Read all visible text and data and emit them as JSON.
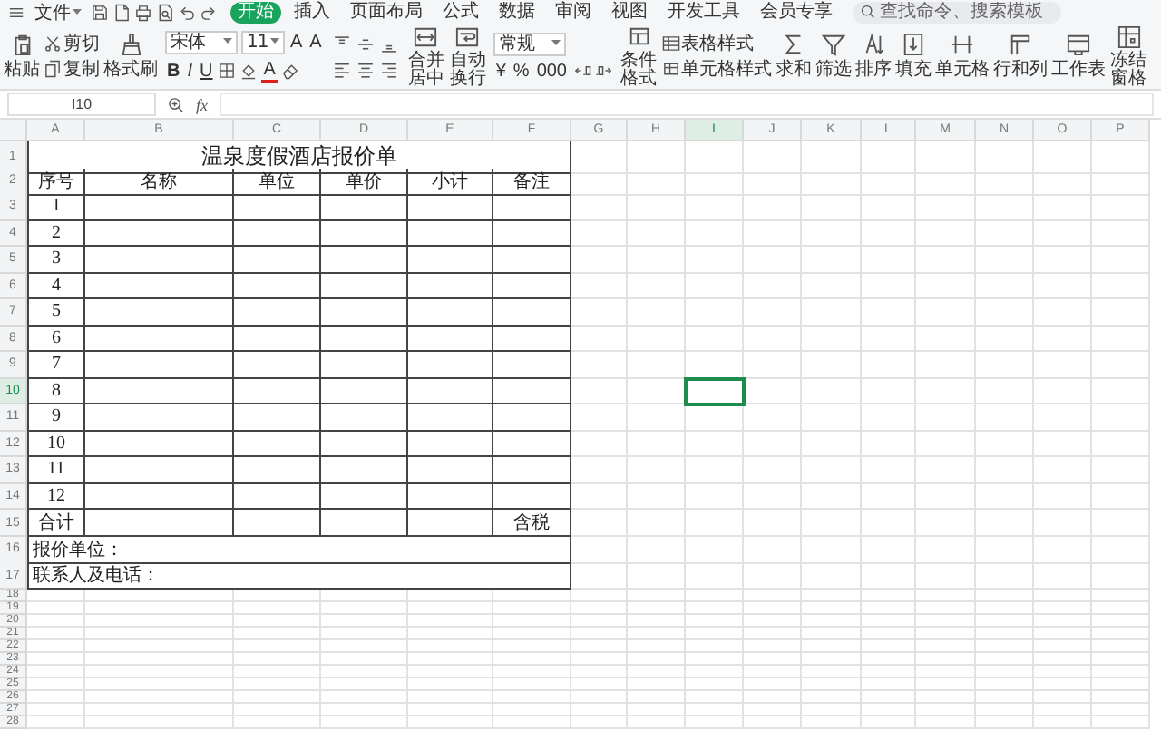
{
  "menu": {
    "file": "文件",
    "tabs": [
      {
        "label": "开始",
        "selected": true
      },
      {
        "label": "插入",
        "selected": false
      },
      {
        "label": "页面布局",
        "selected": false
      },
      {
        "label": "公式",
        "selected": false
      },
      {
        "label": "数据",
        "selected": false
      },
      {
        "label": "审阅",
        "selected": false
      },
      {
        "label": "视图",
        "selected": false
      },
      {
        "label": "开发工具",
        "selected": false
      },
      {
        "label": "会员专享",
        "selected": false
      }
    ],
    "search": {
      "placeholder": "查找命令、搜索模板"
    }
  },
  "ribbon": {
    "items": [
      {
        "kind": "big",
        "label": "粘贴"
      },
      {
        "kind": "stack",
        "labels": [
          "剪切",
          "复制"
        ]
      },
      {
        "kind": "big",
        "label": "格式刷"
      },
      {
        "kind": "font",
        "font": "宋体",
        "size": "11",
        "grow": "A",
        "shrink": "A",
        "styles": [
          "B",
          "I",
          "U"
        ],
        "color_letter": "A"
      },
      {
        "kind": "align"
      },
      {
        "kind": "big",
        "label": "合并居中"
      },
      {
        "kind": "big",
        "label": "自动换行"
      },
      {
        "kind": "number",
        "format": "常规",
        "symbols": [
          "¥",
          "%",
          "000"
        ]
      },
      {
        "kind": "big",
        "label": "条件格式"
      },
      {
        "kind": "stack",
        "labels": [
          "表格样式",
          "单元格样式"
        ]
      },
      {
        "kind": "big",
        "label": "求和"
      },
      {
        "kind": "big",
        "label": "筛选"
      },
      {
        "kind": "big",
        "label": "排序"
      },
      {
        "kind": "big",
        "label": "填充"
      },
      {
        "kind": "big",
        "label": "单元格"
      },
      {
        "kind": "big",
        "label": "行和列"
      },
      {
        "kind": "big",
        "label": "工作表"
      },
      {
        "kind": "big",
        "label": "冻结窗格"
      }
    ]
  },
  "formula_bar": {
    "name_box": "I10",
    "function_label": "fx"
  },
  "sheet": {
    "columns": [
      {
        "label": "A",
        "selected": false
      },
      {
        "label": "B",
        "selected": false
      },
      {
        "label": "C",
        "selected": false
      },
      {
        "label": "D",
        "selected": false
      },
      {
        "label": "E",
        "selected": false
      },
      {
        "label": "F",
        "selected": false
      },
      {
        "label": "G",
        "selected": false
      },
      {
        "label": "H",
        "selected": false
      },
      {
        "label": "I",
        "selected": true
      },
      {
        "label": "J",
        "selected": false
      },
      {
        "label": "K",
        "selected": false
      },
      {
        "label": "L",
        "selected": false
      },
      {
        "label": "M",
        "selected": false
      },
      {
        "label": "N",
        "selected": false
      },
      {
        "label": "O",
        "selected": false
      },
      {
        "label": "P",
        "selected": false
      }
    ],
    "rows": [
      {
        "header": "1",
        "selected": false,
        "kind": "title",
        "text": "温泉度假酒店报价单"
      },
      {
        "header": "2",
        "selected": false,
        "kind": "header",
        "cells": [
          "序号",
          "名称",
          "单位",
          "单价",
          "小计",
          "备注"
        ]
      },
      {
        "header": "3",
        "selected": false,
        "kind": "item",
        "number": "1"
      },
      {
        "header": "4",
        "selected": false,
        "kind": "item",
        "number": "2"
      },
      {
        "header": "5",
        "selected": false,
        "kind": "item",
        "number": "3"
      },
      {
        "header": "6",
        "selected": false,
        "kind": "item",
        "number": "4"
      },
      {
        "header": "7",
        "selected": false,
        "kind": "item",
        "number": "5"
      },
      {
        "header": "8",
        "selected": false,
        "kind": "item",
        "number": "6"
      },
      {
        "header": "9",
        "selected": false,
        "kind": "item",
        "number": "7"
      },
      {
        "header": "10",
        "selected": true,
        "kind": "item",
        "number": "8"
      },
      {
        "header": "11",
        "selected": false,
        "kind": "item",
        "number": "9"
      },
      {
        "header": "12",
        "selected": false,
        "kind": "item",
        "number": "10"
      },
      {
        "header": "13",
        "selected": false,
        "kind": "item",
        "number": "11"
      },
      {
        "header": "14",
        "selected": false,
        "kind": "item",
        "number": "12"
      },
      {
        "header": "15",
        "selected": false,
        "kind": "total",
        "label": "合计",
        "note": "含税"
      },
      {
        "header": "16",
        "selected": false,
        "kind": "text",
        "text": "报价单位："
      },
      {
        "header": "17",
        "selected": false,
        "kind": "text",
        "text": "联系人及电话："
      },
      {
        "header": "18",
        "selected": false,
        "kind": "blank"
      },
      {
        "header": "19",
        "selected": false,
        "kind": "blank"
      },
      {
        "header": "20",
        "selected": false,
        "kind": "blank"
      },
      {
        "header": "21",
        "selected": false,
        "kind": "blank"
      },
      {
        "header": "22",
        "selected": false,
        "kind": "blank"
      },
      {
        "header": "23",
        "selected": false,
        "kind": "blank"
      },
      {
        "header": "24",
        "selected": false,
        "kind": "blank"
      },
      {
        "header": "25",
        "selected": false,
        "kind": "blank"
      },
      {
        "header": "26",
        "selected": false,
        "kind": "blank"
      },
      {
        "header": "27",
        "selected": false,
        "kind": "blank"
      },
      {
        "header": "28",
        "selected": false,
        "kind": "blank"
      }
    ]
  }
}
